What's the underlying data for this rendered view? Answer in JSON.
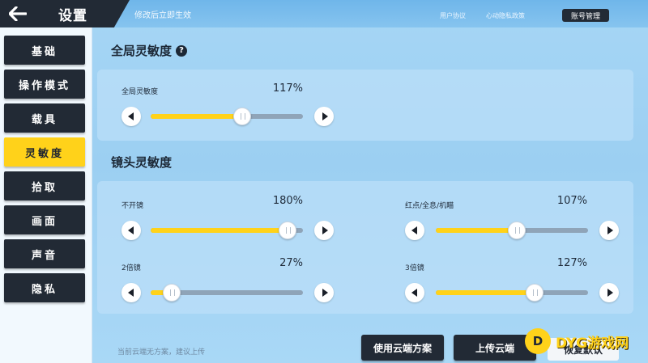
{
  "header": {
    "back_icon": "arrow-left-icon",
    "title": "设置",
    "hint": "修改后立即生效",
    "links": [
      "用户协议",
      "心动隐私政策",
      "账号管理"
    ]
  },
  "sidebar": {
    "items": [
      {
        "label": "基础",
        "active": false
      },
      {
        "label": "操作模式",
        "active": false
      },
      {
        "label": "载具",
        "active": false
      },
      {
        "label": "灵敏度",
        "active": true
      },
      {
        "label": "拾取",
        "active": false
      },
      {
        "label": "画面",
        "active": false
      },
      {
        "label": "声音",
        "active": false
      },
      {
        "label": "隐私",
        "active": false
      }
    ]
  },
  "global_section": {
    "title": "全局灵敏度",
    "help_icon": "question-icon",
    "slider": {
      "label": "全局灵敏度",
      "value_text": "117%",
      "fraction": 0.6
    }
  },
  "camera_section": {
    "title": "镜头灵敏度",
    "sliders": [
      {
        "label": "不开镜",
        "value_text": "180%",
        "fraction": 0.9
      },
      {
        "label": "红点/全息/机瞄",
        "value_text": "107%",
        "fraction": 0.53
      },
      {
        "label": "2倍镜",
        "value_text": "27%",
        "fraction": 0.14
      },
      {
        "label": "3倍镜",
        "value_text": "127%",
        "fraction": 0.65
      }
    ]
  },
  "footer": {
    "hint": "当前云端无方案，建议上传",
    "use_cloud": "使用云端方案",
    "upload_cloud": "上传云端",
    "restore_default": "恢复默认"
  },
  "watermark": {
    "logo_text": "D",
    "text": "DYG游戏网"
  },
  "colors": {
    "accent": "#ffd21a",
    "dark": "#222a35",
    "track": "#8fa4b8"
  }
}
